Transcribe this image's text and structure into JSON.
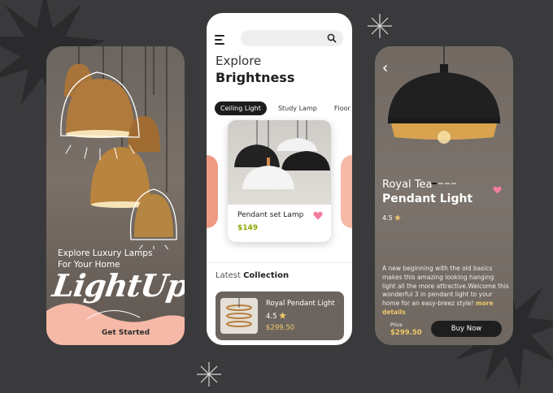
{
  "screen1": {
    "tagline": "Explore Luxury Lamps For Your Home",
    "script_title": "LightUp",
    "cta_label": "Get Started"
  },
  "screen2": {
    "search": {
      "placeholder": ""
    },
    "heading_light": "Explore",
    "heading_bold": "Brightness",
    "tabs": [
      {
        "label": "Ceiling Light",
        "active": true
      },
      {
        "label": "Study Lamp",
        "active": false
      },
      {
        "label": "Floor Lamp",
        "active": false
      }
    ],
    "featured": {
      "name": "Pendant set Lamp",
      "price": "$149"
    },
    "section": {
      "prefix": "Latest",
      "title": "Collection"
    },
    "list": [
      {
        "name": "Royal Pendant Light",
        "rating": "4.5",
        "price": "$299.50"
      }
    ]
  },
  "screen3": {
    "title_line1": "Royal Tea",
    "title_line2": "Pendant Light",
    "rating": "4.5",
    "description": "A new beginning with the old basics makes this amazing looking hanging light all the more attractive.Welcome this wonderful 3 in pendant light to your home for an easy-breez style!",
    "more_link": "more details",
    "price_label": "Price",
    "price": "$299.50",
    "buy_label": "Buy Now"
  },
  "colors": {
    "background": "#3a3a3c",
    "accent_gold": "#f0c96a",
    "price_green": "#8fa600",
    "peach": "#f6b9a7",
    "heart_pink": "#f27d9c",
    "dark_button": "#1e1e1e"
  },
  "icons": [
    "menu-icon",
    "search-icon",
    "heart-icon",
    "star-icon",
    "back-arrow-icon"
  ]
}
